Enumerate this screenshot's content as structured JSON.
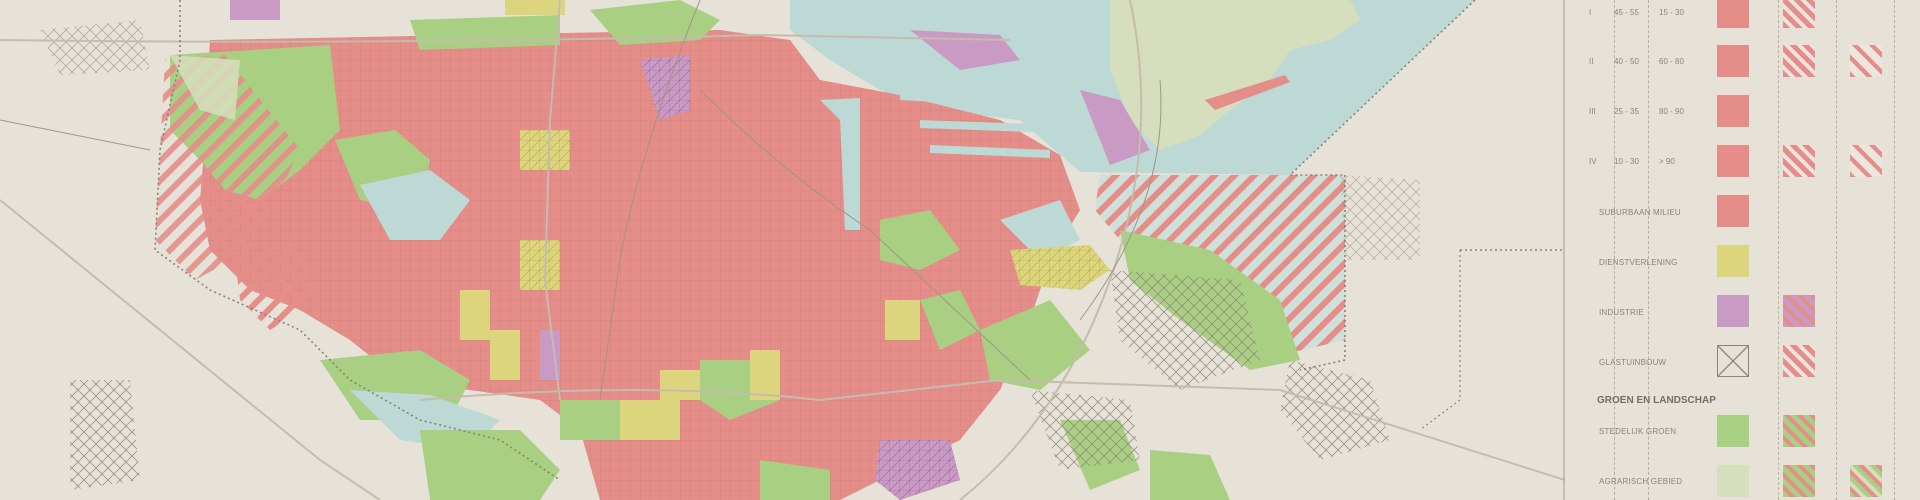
{
  "legend": {
    "density_rows": [
      {
        "symbol": "I",
        "col1": "45 - 55",
        "col2": "15 - 30"
      },
      {
        "symbol": "II",
        "col1": "40 - 50",
        "col2": "60 - 80"
      },
      {
        "symbol": "III",
        "col1": "25 - 35",
        "col2": "80 - 90"
      },
      {
        "symbol": "IV",
        "col1": "10 - 30",
        "col2": "> 90"
      }
    ],
    "categories": [
      {
        "label": "SUBURBAAN MILIEU"
      },
      {
        "label": "DIENSTVERLENING"
      },
      {
        "label": "INDUSTRIE"
      },
      {
        "label": "GLASTUINBOUW"
      }
    ],
    "section_heading": "GROEN EN LANDSCHAP",
    "green_categories": [
      {
        "label": "STEDELIJK GROEN"
      },
      {
        "label": "AGRARISCH GEBIED"
      }
    ]
  },
  "colors": {
    "paper": "#e7e2d7",
    "urban": "#e48d89",
    "green": "#a9cf83",
    "service": "#ddd57e",
    "industry": "#c99ac3",
    "water": "#bcd9d6",
    "agrarian": "#d5dfbd",
    "hatch_red": "#d9726f"
  }
}
